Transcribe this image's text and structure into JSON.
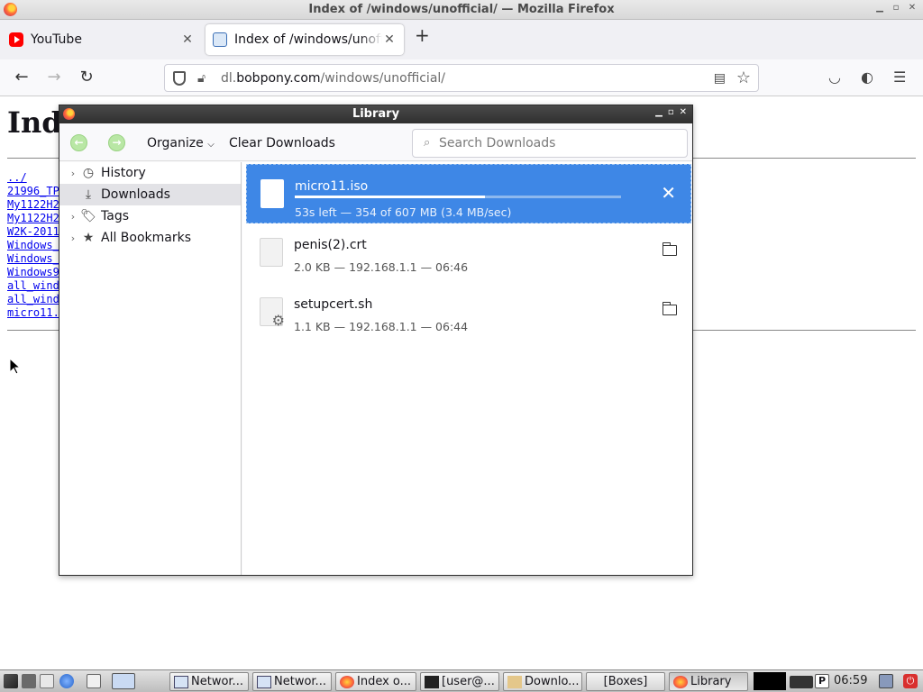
{
  "window": {
    "title": "Index of /windows/unofficial/ — Mozilla Firefox"
  },
  "tabs": [
    {
      "label": "YouTube",
      "icon": "youtube-icon"
    },
    {
      "label": "Index of /windows/unofficial/",
      "icon": "page-icon"
    }
  ],
  "navbar": {
    "url_prefix": "dl.",
    "url_domain": "bobpony.com",
    "url_path": "/windows/unofficial/"
  },
  "page": {
    "heading": "Ind",
    "links": [
      "../",
      "21996_TP",
      "My1122H2",
      "My1122H2",
      "W2K-2011",
      "Windows_",
      "Windows_",
      "Windows9",
      "all_wind",
      "all_wind",
      "micro11."
    ]
  },
  "library": {
    "title": "Library",
    "toolbar": {
      "organize": "Organize",
      "clear": "Clear Downloads",
      "search_placeholder": "Search Downloads"
    },
    "sidebar": [
      {
        "label": "History",
        "expandable": true,
        "icon": "clock-icon"
      },
      {
        "label": "Downloads",
        "expandable": false,
        "icon": "download-icon",
        "selected": true
      },
      {
        "label": "Tags",
        "expandable": true,
        "icon": "tag-icon"
      },
      {
        "label": "All Bookmarks",
        "expandable": true,
        "icon": "star-icon"
      }
    ],
    "downloads": [
      {
        "name": "micro11.iso",
        "meta": "53s left — 354 of 607 MB (3.4 MB/sec)",
        "progress": 0.583,
        "selected": true,
        "action": "cancel"
      },
      {
        "name": "penis(2).crt",
        "meta": "2.0 KB — 192.168.1.1 — 06:46",
        "action": "open-folder"
      },
      {
        "name": "setupcert.sh",
        "meta": "1.1 KB — 192.168.1.1 — 06:44",
        "action": "open-folder"
      }
    ]
  },
  "taskbar": {
    "tasks": [
      "Networ...",
      "Networ...",
      "Index o...",
      "[user@...",
      "Downlo...",
      "[Boxes]",
      "Library"
    ],
    "clock": "06:59"
  }
}
